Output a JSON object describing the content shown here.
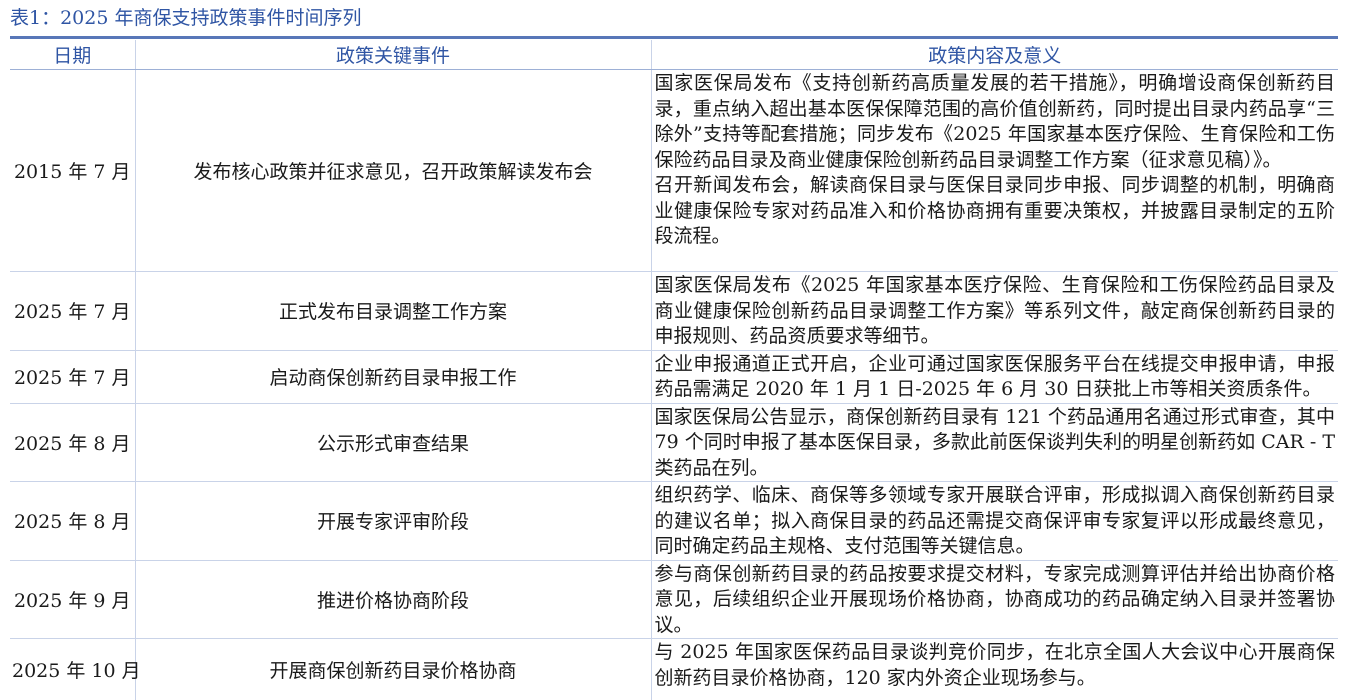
{
  "caption": "表1：2025 年商保支持政策事件时间序列",
  "headers": [
    "日期",
    "政策关键事件",
    "政策内容及意义"
  ],
  "rows": [
    {
      "date": "2015 年 7 月",
      "event": "发布核心政策并征求意见，召开政策解读发布会",
      "content": [
        "国家医保局发布《支持创新药高质量发展的若干措施》，明确增设商保创新药目录，重点纳入超出基本医保保障范围的高价值创新药，同时提出目录内药品享“三除外”支持等配套措施；同步发布《2025 年国家基本医疗保险、生育保险和工伤保险药品目录及商业健康保险创新药品目录调整工作方案（征求意见稿）》。",
        "召开新闻发布会，解读商保目录与医保目录同步申报、同步调整的机制，明确商业健康保险专家对药品准入和价格协商拥有重要决策权，并披露目录制定的五阶段流程。"
      ]
    },
    {
      "date": "2025 年 7 月",
      "event": "正式发布目录调整工作方案",
      "content": [
        "国家医保局发布《2025 年国家基本医疗保险、生育保险和工伤保险药品目录及商业健康保险创新药品目录调整工作方案》等系列文件，敲定商保创新药目录的申报规则、药品资质要求等细节。"
      ]
    },
    {
      "date": "2025 年 7 月",
      "event": "启动商保创新药目录申报工作",
      "content": [
        "企业申报通道正式开启，企业可通过国家医保服务平台在线提交申报申请，申报药品需满足 2020 年 1 月 1 日-2025 年 6 月 30 日获批上市等相关资质条件。"
      ]
    },
    {
      "date": "2025 年 8 月",
      "event": "公示形式审查结果",
      "content": [
        "国家医保局公告显示，商保创新药目录有 121 个药品通用名通过形式审查，其中 79 个同时申报了基本医保目录，多款此前医保谈判失利的明星创新药如 CAR - T 类药品在列。"
      ]
    },
    {
      "date": "2025 年 8 月",
      "event": "开展专家评审阶段",
      "content": [
        "组织药学、临床、商保等多领域专家开展联合评审，形成拟调入商保创新药目录的建议名单；拟入商保目录的药品还需提交商保评审专家复评以形成最终意见，同时确定药品主规格、支付范围等关键信息。"
      ]
    },
    {
      "date": "2025 年 9 月",
      "event": "推进价格协商阶段",
      "content": [
        "参与商保创新药目录的药品按要求提交材料，专家完成测算评估并给出协商价格意见，后续组织企业开展现场价格协商，协商成功的药品确定纳入目录并签署协议。"
      ]
    },
    {
      "date": "2025 年 10 月",
      "event": "开展商保创新药目录价格协商",
      "content": [
        "与 2025 年国家医保药品目录谈判竞价同步，在北京全国人大会议中心开展商保创新药目录价格协商，120 家内外资企业现场参与。"
      ]
    }
  ]
}
